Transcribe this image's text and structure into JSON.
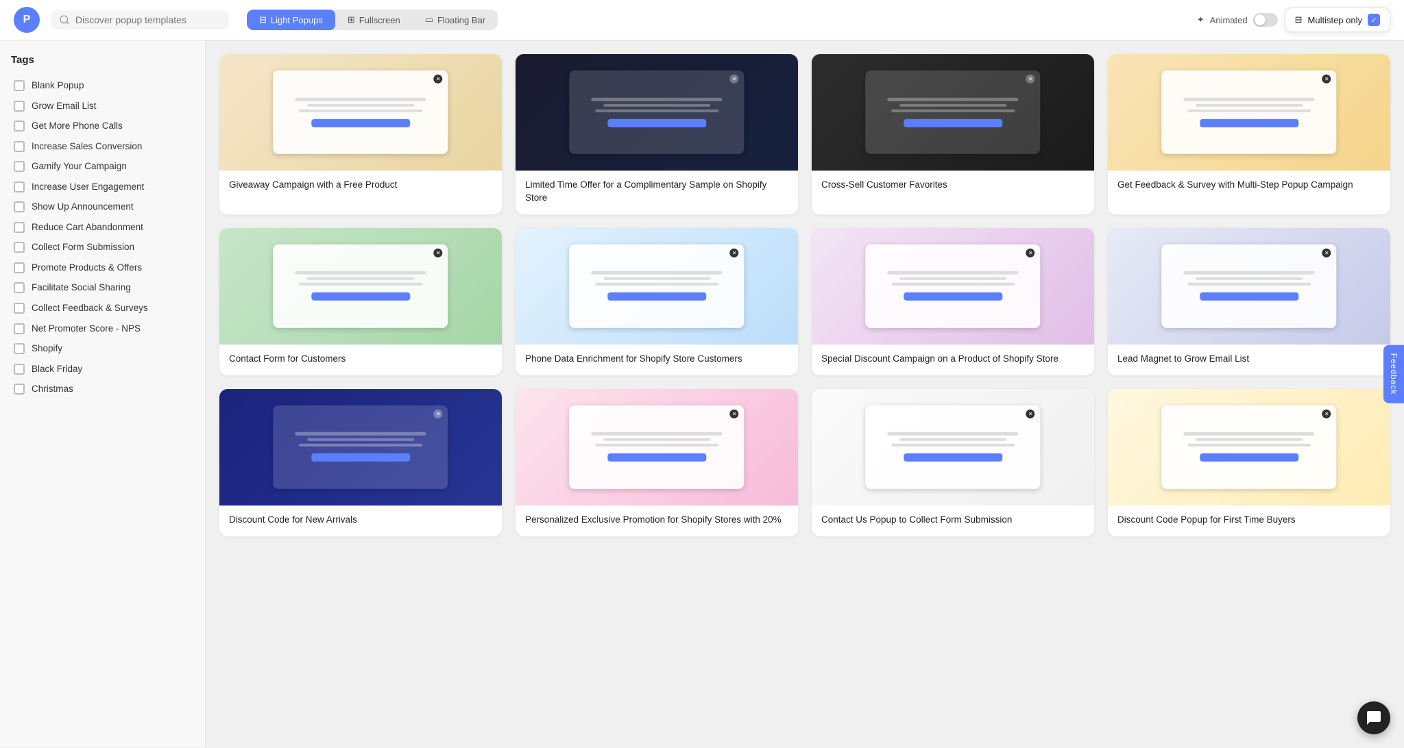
{
  "header": {
    "logo_text": "P",
    "search_placeholder": "Discover popup templates",
    "tabs": [
      {
        "id": "light-popups",
        "label": "Light Popups",
        "icon": "▣",
        "active": true
      },
      {
        "id": "fullscreen",
        "label": "Fullscreen",
        "icon": "⊞",
        "active": false
      },
      {
        "id": "floating-bar",
        "label": "Floating Bar",
        "icon": "▭",
        "active": false
      }
    ],
    "animated_label": "Animated",
    "multistep_label": "Multistep only"
  },
  "sidebar": {
    "title": "Tags",
    "tags": [
      {
        "id": "blank-popup",
        "label": "Blank Popup",
        "checked": false
      },
      {
        "id": "grow-email-list",
        "label": "Grow Email List",
        "checked": false
      },
      {
        "id": "get-more-phone-calls",
        "label": "Get More Phone Calls",
        "checked": false
      },
      {
        "id": "increase-sales-conversion",
        "label": "Increase Sales Conversion",
        "checked": false
      },
      {
        "id": "gamify-your-campaign",
        "label": "Gamify Your Campaign",
        "checked": false
      },
      {
        "id": "increase-user-engagement",
        "label": "Increase User Engagement",
        "checked": false
      },
      {
        "id": "show-up-announcement",
        "label": "Show Up Announcement",
        "checked": false
      },
      {
        "id": "reduce-cart-abandonment",
        "label": "Reduce Cart Abandonment",
        "checked": false
      },
      {
        "id": "collect-form-submission",
        "label": "Collect Form Submission",
        "checked": false
      },
      {
        "id": "promote-products-offers",
        "label": "Promote Products & Offers",
        "checked": false
      },
      {
        "id": "facilitate-social-sharing",
        "label": "Facilitate Social Sharing",
        "checked": false
      },
      {
        "id": "collect-feedback-surveys",
        "label": "Collect Feedback & Surveys",
        "checked": false
      },
      {
        "id": "net-promoter-score",
        "label": "Net Promoter Score - NPS",
        "checked": false
      },
      {
        "id": "shopify",
        "label": "Shopify",
        "checked": false
      },
      {
        "id": "black-friday",
        "label": "Black Friday",
        "checked": false
      },
      {
        "id": "christmas",
        "label": "Christmas",
        "checked": false
      }
    ]
  },
  "cards": [
    {
      "id": "card-1",
      "title": "Giveaway Campaign with a Free Product",
      "theme": "mock-cat"
    },
    {
      "id": "card-2",
      "title": "Limited Time Offer for a Complimentary Sample on Shopify Store",
      "theme": "mock-luxury"
    },
    {
      "id": "card-3",
      "title": "Cross-Sell Customer Favorites",
      "theme": "mock-burger"
    },
    {
      "id": "card-4",
      "title": "Get Feedback & Survey with Multi-Step Popup Campaign",
      "theme": "mock-survey"
    },
    {
      "id": "card-5",
      "title": "Contact Form for Customers",
      "theme": "mock-contact"
    },
    {
      "id": "card-6",
      "title": "Phone Data Enrichment for Shopify Store Customers",
      "theme": "mock-phone"
    },
    {
      "id": "card-7",
      "title": "Special Discount Campaign on a Product of Shopify Store",
      "theme": "mock-chairs"
    },
    {
      "id": "card-8",
      "title": "Lead Magnet to Grow Email List",
      "theme": "mock-lead"
    },
    {
      "id": "card-9",
      "title": "Discount Code for New Arrivals",
      "theme": "mock-discount"
    },
    {
      "id": "card-10",
      "title": "Personalized Exclusive Promotion for Shopify Stores with 20%",
      "theme": "mock-promo"
    },
    {
      "id": "card-11",
      "title": "Contact Us Popup to Collect Form Submission",
      "theme": "mock-contactus"
    },
    {
      "id": "card-12",
      "title": "Discount Code Popup for First Time Buyers",
      "theme": "mock-first"
    }
  ],
  "feedback_button": "Feedback",
  "chat_icon": "💬"
}
